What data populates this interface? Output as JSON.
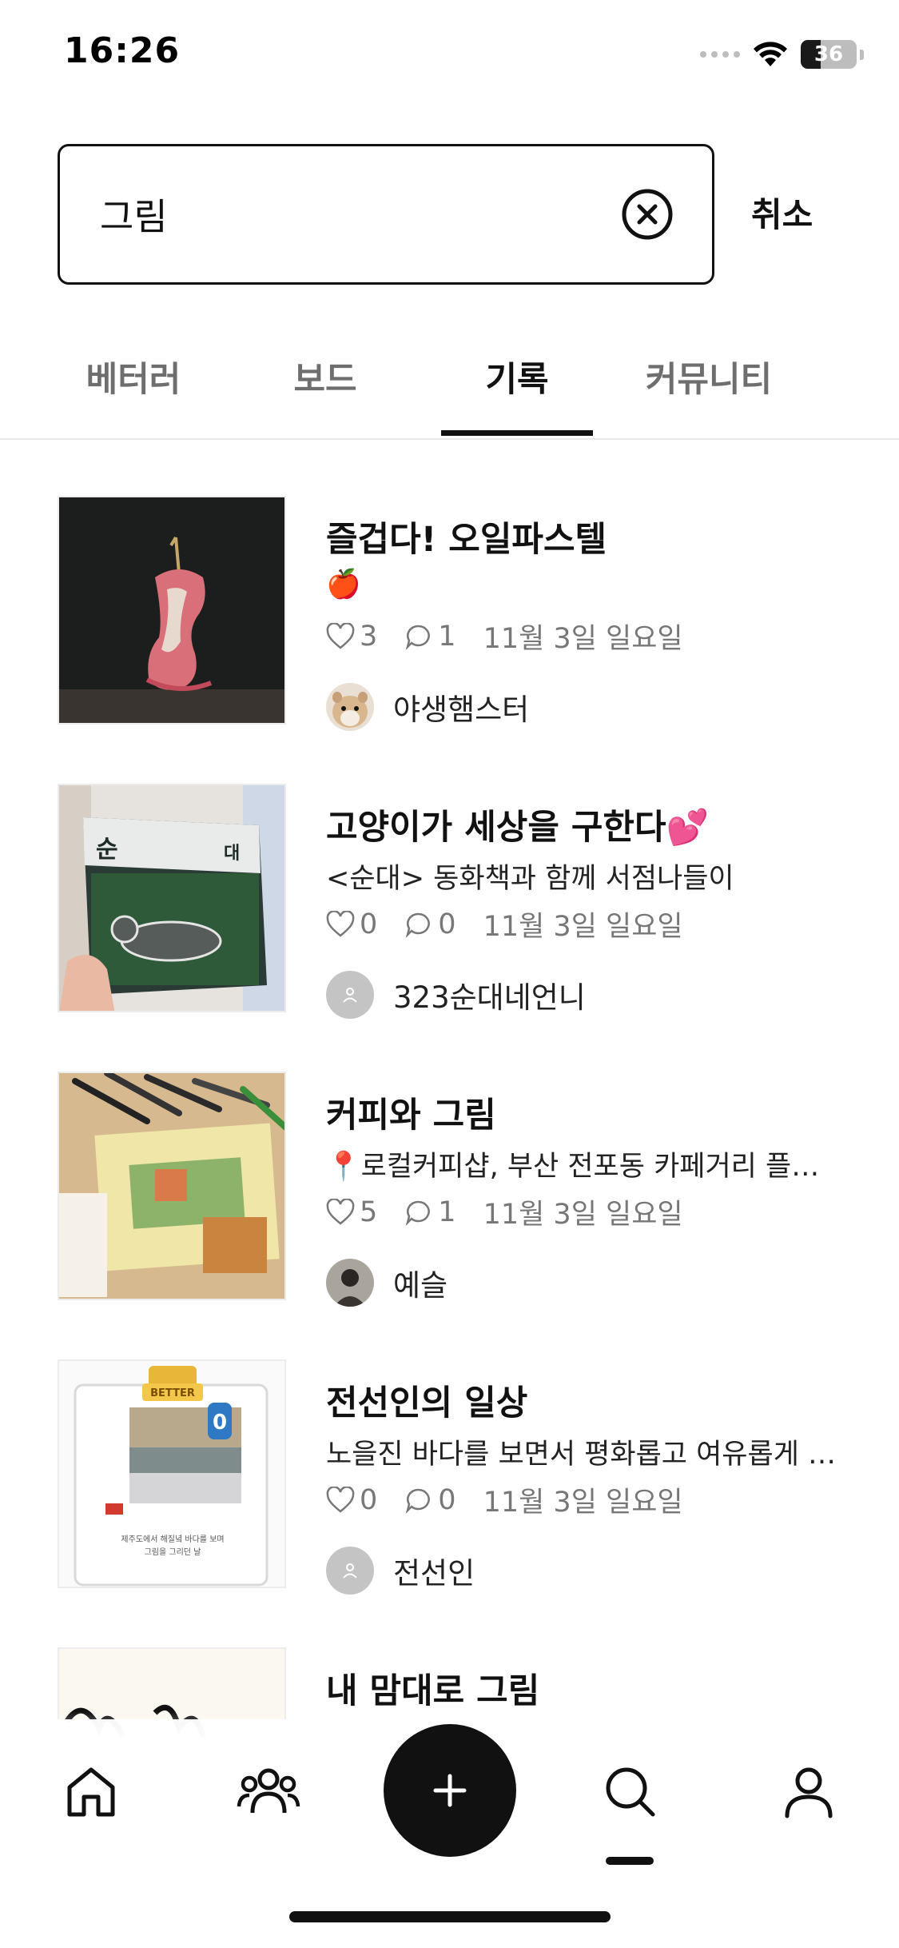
{
  "status_bar": {
    "time": "16:26",
    "battery": "36"
  },
  "search": {
    "query": "그림",
    "cancel_label": "취소"
  },
  "tabs": [
    {
      "label": "베터러",
      "active": false
    },
    {
      "label": "보드",
      "active": false
    },
    {
      "label": "기록",
      "active": true
    },
    {
      "label": "커뮤니티",
      "active": false
    }
  ],
  "results": [
    {
      "title": "즐겁다! 오일파스텔",
      "subtitle": "🍎",
      "likes": "3",
      "comments": "1",
      "date": "11월 3일 일요일",
      "author": "야생햄스터",
      "avatar": "hamster"
    },
    {
      "title": "고양이가 세상을 구한다💕",
      "subtitle": "<순대> 동화책과 함께 서점나들이",
      "likes": "0",
      "comments": "0",
      "date": "11월 3일 일요일",
      "author": "323순대네언니",
      "avatar": "default"
    },
    {
      "title": "커피와 그림",
      "subtitle": "📍로컬커피샵, 부산 전포동 카페거리 플…",
      "likes": "5",
      "comments": "1",
      "date": "11월 3일 일요일",
      "author": "예슬",
      "avatar": "photo"
    },
    {
      "title": "전선인의 일상",
      "subtitle": "노을진 바다를 보면서 평화롭고 여유롭게 …",
      "likes": "0",
      "comments": "0",
      "date": "11월 3일 일요일",
      "author": "전선인",
      "avatar": "default"
    },
    {
      "title": "내 맘대로 그림"
    }
  ],
  "thumbnail_text": {
    "book_left": "순",
    "book_right": "대",
    "card_badge": "BETTER",
    "card_number": "0",
    "card_caption_1": "제주도에서 해질녘 바다를 보며",
    "card_caption_2": "그림을 그리던 날"
  },
  "bottom_nav": [
    "home-icon",
    "community-icon",
    "add-icon",
    "search-icon",
    "profile-icon"
  ],
  "colors": {
    "text": "#111111",
    "muted": "#777777",
    "tab_inactive": "#6e6e6e",
    "accent": "#111111"
  }
}
